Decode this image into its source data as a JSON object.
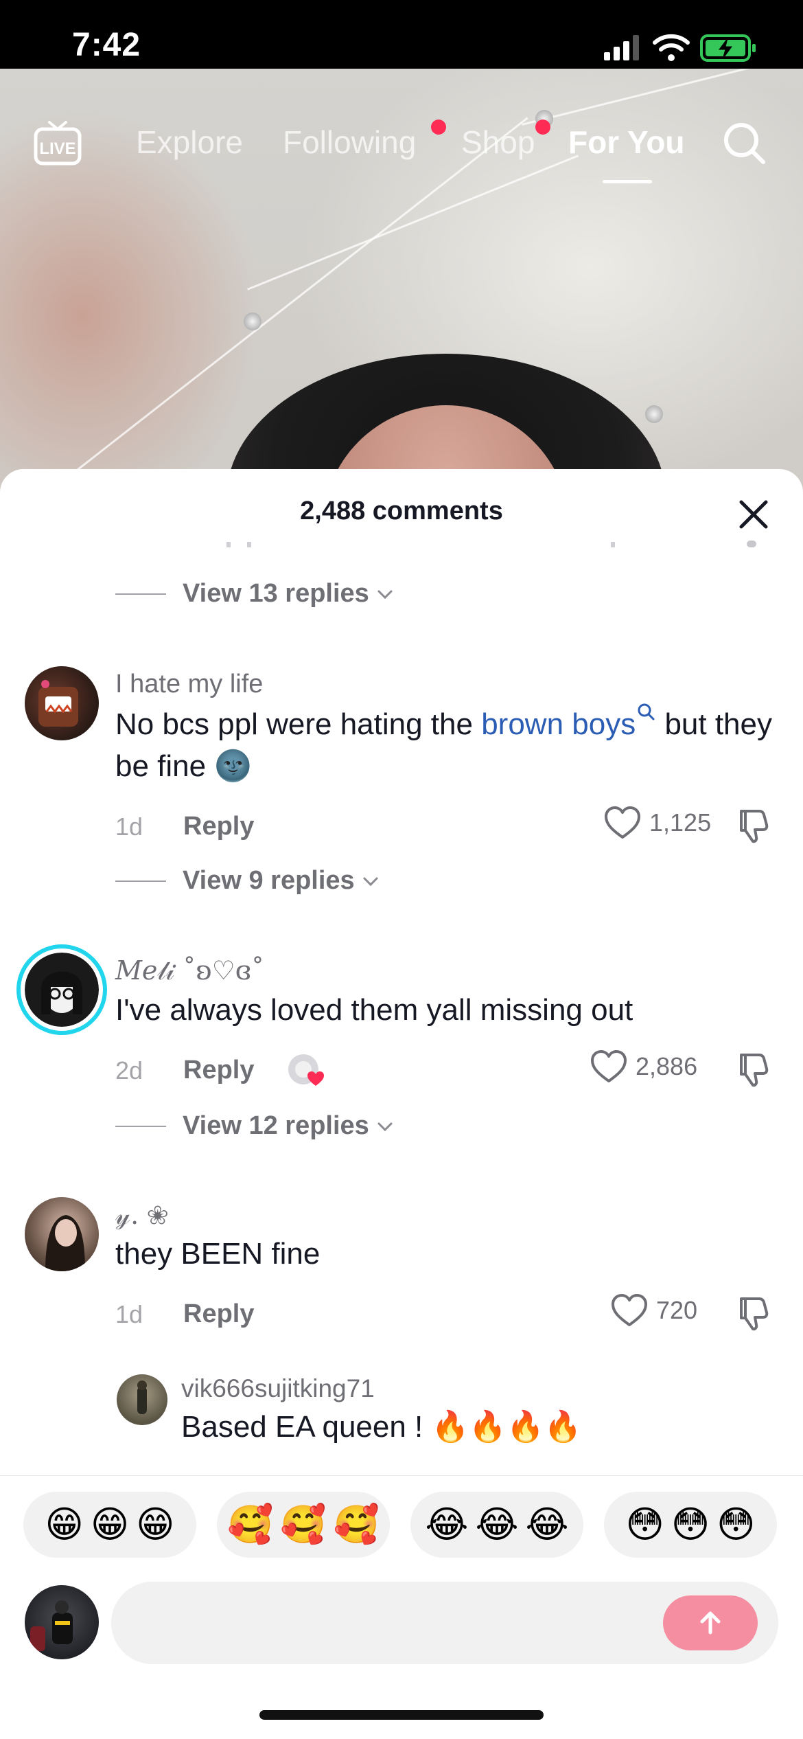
{
  "status_bar": {
    "time": "7:42"
  },
  "top_nav": {
    "live_label": "LIVE",
    "tabs": [
      {
        "label": "Explore"
      },
      {
        "label": "Following"
      },
      {
        "label": "Shop"
      },
      {
        "label": "For You"
      }
    ],
    "active_tab": "For You"
  },
  "comments_sheet": {
    "title": "2,488 comments",
    "items": [
      {
        "view_replies": "View 13 replies"
      },
      {
        "username": "I hate my life",
        "text_before": "No bcs ppl were hating the ",
        "link": "brown boys",
        "text_after": " but they be fine 🌚",
        "time": "1d",
        "reply_label": "Reply",
        "likes": "1,125",
        "view_replies": "View 9 replies"
      },
      {
        "username": "𝑀𝑒𝓁𝒾 ˚ʚ♡ɞ˚",
        "text": "I've always loved them yall missing out",
        "time": "2d",
        "reply_label": "Reply",
        "likes": "2,886",
        "view_replies": "View 12 replies"
      },
      {
        "username": "𝓎. ❀",
        "text": "they BEEN fine",
        "time": "1d",
        "reply_label": "Reply",
        "likes": "720"
      },
      {
        "username": "vik666sujitking71",
        "text": "Based EA queen ! 🔥🔥🔥🔥"
      }
    ]
  },
  "quick_emojis": [
    [
      "😁",
      "😁",
      "😁"
    ],
    [
      "🥰",
      "🥰",
      "🥰"
    ],
    [
      "😂",
      "😂",
      "😂"
    ],
    [
      "😳",
      "😳",
      "😳"
    ]
  ],
  "input": {
    "placeholder": ""
  },
  "colors": {
    "accent": "#fe2c55",
    "link": "#2b5db5",
    "send_button": "#f58ea1",
    "text": "#161823",
    "muted": "#6e6e75"
  },
  "icons": [
    "live-icon",
    "search-icon",
    "close-icon",
    "chevron-down-icon",
    "heart-icon",
    "dislike-icon",
    "send-arrow-icon",
    "wifi-icon",
    "battery-icon",
    "signal-icon"
  ]
}
